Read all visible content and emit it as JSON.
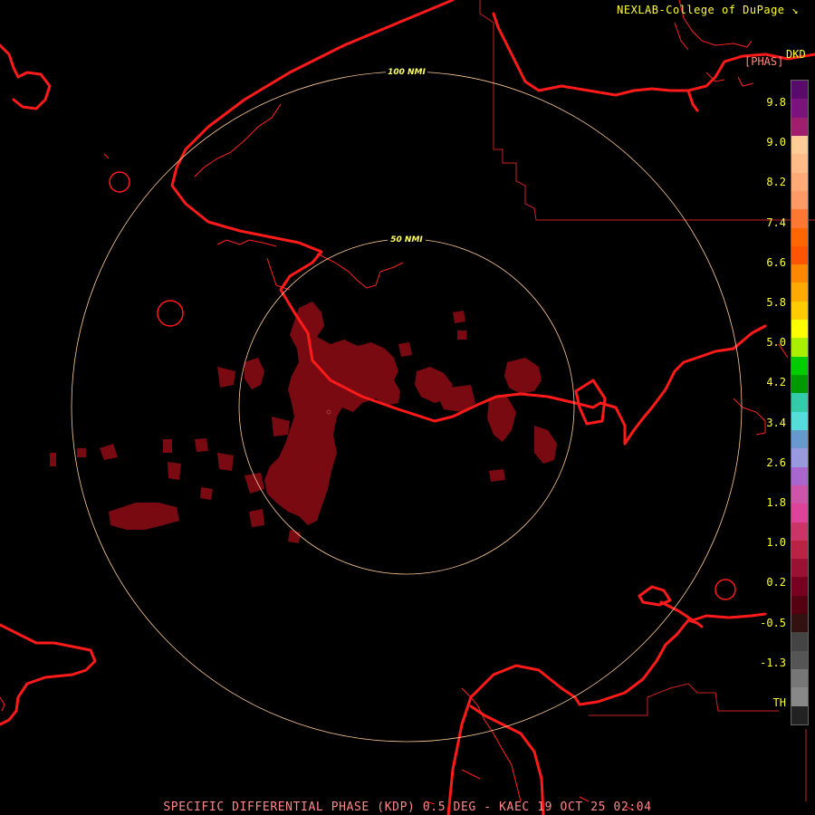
{
  "credit": "NEXLAB-College of DuPage",
  "credit_icon": "arrow-corner-icon",
  "product_code": "DKD",
  "units": "[PHAS]",
  "footer": "SPECIFIC DIFFERENTIAL PHASE (KDP) 0.5 DEG - KAEC 19 OCT 25 02:04",
  "range_rings": [
    {
      "label": "100 NMI"
    },
    {
      "label": "50 NMI"
    }
  ],
  "colorbar": {
    "labels": [
      "9.8",
      "9.0",
      "8.2",
      "7.4",
      "6.6",
      "5.8",
      "5.0",
      "4.2",
      "3.4",
      "2.6",
      "1.8",
      "1.0",
      "0.2",
      "-0.5",
      "-1.3",
      "TH"
    ],
    "colors": [
      "#5a0a6a",
      "#7a147a",
      "#a01e6e",
      "#ffcc99",
      "#ffbb88",
      "#ffaa77",
      "#ff9966",
      "#ff7733",
      "#ff6600",
      "#ff5500",
      "#ff8800",
      "#ffaa00",
      "#ffcc00",
      "#ffff00",
      "#aaee00",
      "#00cc00",
      "#009900",
      "#33ccaa",
      "#55dddd",
      "#6699cc",
      "#9999dd",
      "#aa66cc",
      "#cc55aa",
      "#dd4499",
      "#cc3366",
      "#bb2244",
      "#991133",
      "#770022",
      "#550011",
      "#331111",
      "#444444",
      "#555555",
      "#777777",
      "#888888",
      "#222222"
    ]
  },
  "colors": {
    "coastline": "#ff1a1a",
    "border": "#cc2222",
    "ring": "#ffcc99",
    "echo": "#7a0a12"
  }
}
